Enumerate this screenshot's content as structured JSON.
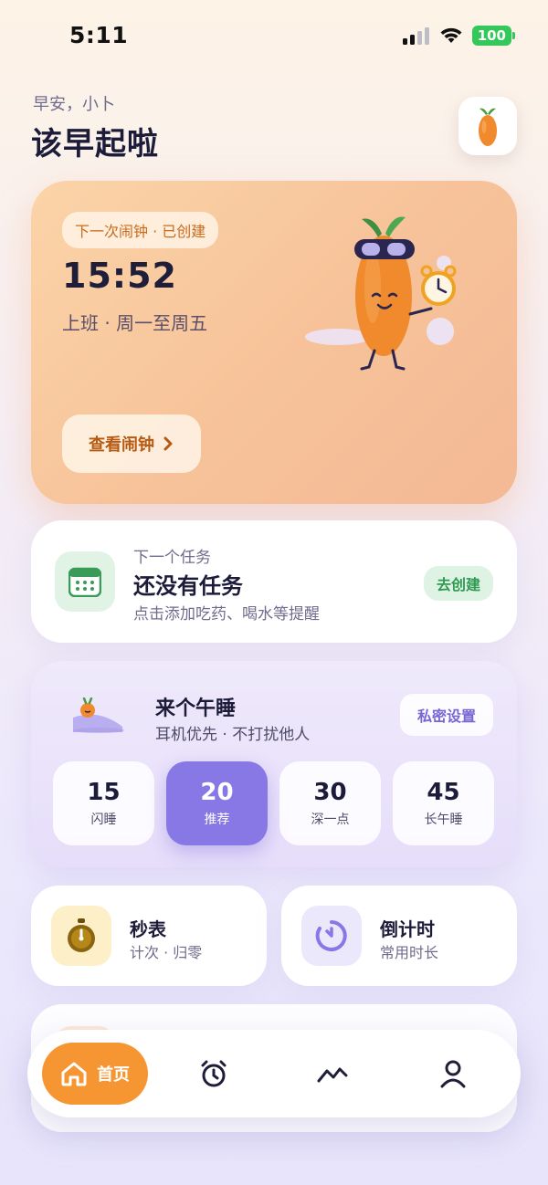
{
  "status_bar": {
    "time": "5:11",
    "battery": "100"
  },
  "header": {
    "greeting": "早安，小卜",
    "title": "该早起啦"
  },
  "alarm_card": {
    "badge": "下一次闹钟 · 已创建",
    "time": "15:52",
    "subtitle": "上班 · 周一至周五",
    "button_label": "查看闹钟"
  },
  "task_card": {
    "label": "下一个任务",
    "title": "还没有任务",
    "hint": "点击添加吃药、喝水等提醒",
    "action": "去创建"
  },
  "nap_card": {
    "title": "来个午睡",
    "subtitle": "耳机优先 · 不打扰他人",
    "privacy_button": "私密设置",
    "options": [
      {
        "num": "15",
        "label": "闪睡"
      },
      {
        "num": "20",
        "label": "推荐"
      },
      {
        "num": "30",
        "label": "深一点"
      },
      {
        "num": "45",
        "label": "长午睡"
      }
    ],
    "selected_index": 1
  },
  "tools": [
    {
      "title": "秒表",
      "subtitle": "计次 · 归零",
      "icon": "stopwatch-icon"
    },
    {
      "title": "倒计时",
      "subtitle": "常用时长",
      "icon": "countdown-icon"
    }
  ],
  "tab_bar": {
    "home_label": "首页",
    "items": [
      "home-icon",
      "alarm-clock-icon",
      "trend-chart-icon",
      "profile-icon"
    ]
  },
  "colors": {
    "accent_orange": "#f59633",
    "accent_purple": "#8878e6",
    "accent_green": "#2e9a52",
    "text_primary": "#1c1b3a"
  }
}
